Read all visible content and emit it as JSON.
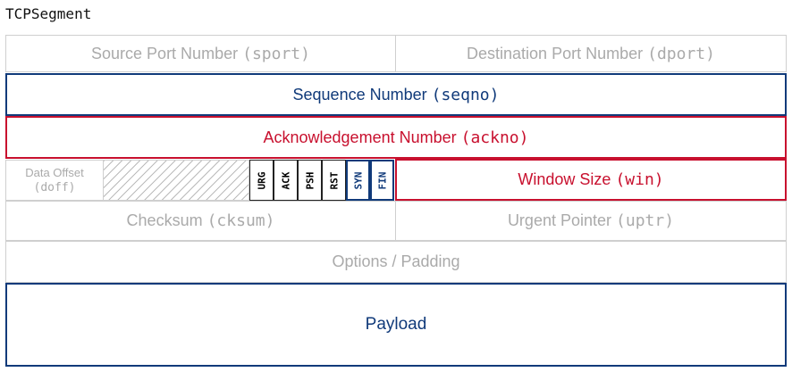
{
  "title": "TCPSegment",
  "rows": {
    "sport": {
      "label": "Source Port Number",
      "field": "(sport)"
    },
    "dport": {
      "label": "Destination Port Number",
      "field": "(dport)"
    },
    "seqno": {
      "label": "Sequence Number",
      "field": "(seqno)"
    },
    "ackno": {
      "label": "Acknowledgement Number",
      "field": "(ackno)"
    },
    "doff": {
      "label": "Data Offset",
      "field": "(doff)"
    },
    "win": {
      "label": "Window Size",
      "field": "(win)"
    },
    "cksum": {
      "label": "Checksum",
      "field": "(cksum)"
    },
    "uptr": {
      "label": "Urgent Pointer",
      "field": "(uptr)"
    },
    "options": {
      "label": "Options / Padding"
    },
    "payload": {
      "label": "Payload"
    }
  },
  "flags": [
    "URG",
    "ACK",
    "PSH",
    "RST",
    "SYN",
    "FIN"
  ],
  "colors": {
    "gray": "#aaaaaa",
    "blue": "#103a7a",
    "red": "#c8102e",
    "border_gray": "#cfcfcf"
  }
}
